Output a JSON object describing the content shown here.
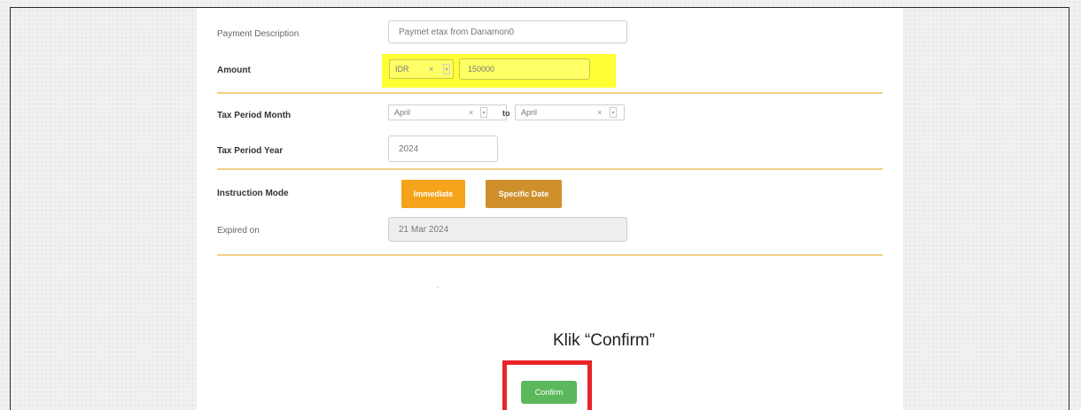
{
  "form": {
    "payment_description_label": "Payment Description",
    "payment_description_value": "Paymet etax from Danamon0",
    "amount_label": "Amount",
    "currency_value": "IDR",
    "amount_value": "150000",
    "tax_month_label": "Tax Period Month",
    "month_from": "April",
    "to_text": "to",
    "month_to": "April",
    "tax_year_label": "Tax Period Year",
    "tax_year_value": "2024",
    "instruction_mode_label": "Instruction Mode",
    "immediate_label": "Immediate",
    "specific_date_label": "Specific Date",
    "expired_label": "Expired on",
    "expired_value": "21 Mar 2024",
    "clear_glyph": "×",
    "arrow_glyph": "▾",
    "stray_mark": "'",
    "confirm_label": "Confirm"
  },
  "annotation": {
    "instruction": "Klik “Confirm”"
  },
  "colors": {
    "highlight": "#ffff33",
    "immediate": "#f5a31a",
    "specific_date": "#cf8f2b",
    "confirm": "#5cb85c",
    "annotation_box": "#e8232a",
    "divider": "#f2cf86"
  }
}
